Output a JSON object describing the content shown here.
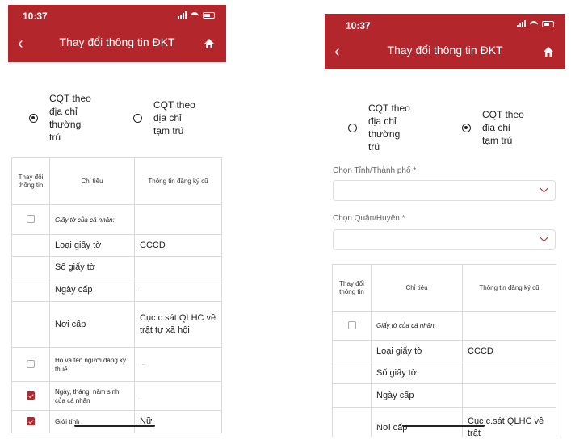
{
  "colors": {
    "header": "#b3262c",
    "accent": "#b3262c"
  },
  "left": {
    "time": "10:37",
    "title": "Thay đổi thông tin ĐKT",
    "radio_thuong_tru": "CQT theo\nđịa chỉ\nthường\ntrú",
    "radio_tam_tru": "CQT theo\nđịa chỉ\ntạm trú",
    "headers": [
      "Thay đổi thông tin",
      "Chỉ tiêu",
      "Thông tin đăng ký cũ"
    ],
    "rows": [
      {
        "label": "Giấy tờ của cá nhân:",
        "value": ""
      },
      {
        "label": "Loại giấy tờ",
        "value": "CCCD"
      },
      {
        "label": "Số giấy tờ",
        "value": ""
      },
      {
        "label": "Ngày cấp",
        "value": "·"
      },
      {
        "label": "Nơi cấp",
        "value": "Cục c.sát QLHC về trật tự xã hội"
      },
      {
        "label": "Họ và tên người đăng ký thuế",
        "value": "···"
      },
      {
        "label": "Ngày, tháng, năm sinh của cá nhân",
        "value": "·"
      },
      {
        "label": "Giới tính",
        "value": "Nữ"
      }
    ]
  },
  "right": {
    "time": "10:37",
    "title": "Thay đổi thông tin ĐKT",
    "radio_thuong_tru": "CQT theo\nđịa chỉ\nthường\ntrú",
    "radio_tam_tru": "CQT theo\nđịa chỉ\ntạm trú",
    "province_label": "Chọn Tỉnh/Thành phố *",
    "district_label": "Chọn Quận/Huyện *",
    "province_value": "",
    "district_value": "",
    "headers": [
      "Thay đổi thông tin",
      "Chỉ tiêu",
      "Thông tin đăng ký cũ"
    ],
    "rows": [
      {
        "label": "Giấy tờ của cá nhân:",
        "value": ""
      },
      {
        "label": "Loại giấy tờ",
        "value": "CCCD"
      },
      {
        "label": "Số giấy tờ",
        "value": ""
      },
      {
        "label": "Ngày cấp",
        "value": ""
      },
      {
        "label": "Nơi cấp",
        "value": "Cục c.sát QLHC về trật"
      }
    ]
  }
}
